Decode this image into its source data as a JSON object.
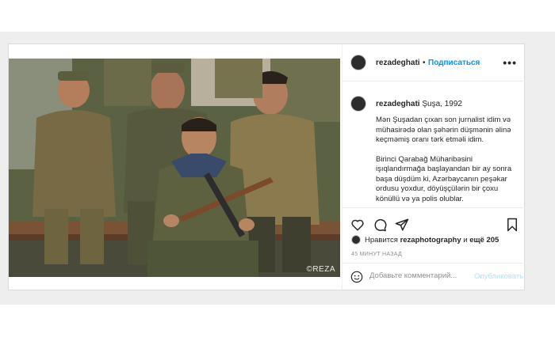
{
  "post": {
    "username": "rezadeghati",
    "follow_label": "Подписаться",
    "separator": "•",
    "more_label": "•••",
    "caption": {
      "username": "rezadeghati",
      "location_year": "Şuşa, 1992",
      "paragraphs": [
        "Mən Şuşadan çıxan son jurnalist idim və mühasirədə olan şəhərin düşmənin əlinə keçməmiş oranı tərk etməli idim.",
        "Birinci Qarabağ Müharibəsini işıqlandırmağa başlayandan bir ay sonra başa düşdüm ki, Azərbaycanın peşəkar ordusu yoxdur, döyüşçülərin bir çoxu könüllü və ya polis olublar."
      ]
    },
    "photo": {
      "watermark": "©REZA"
    },
    "likes": {
      "prefix": "Нравится",
      "user": "rezaphotography",
      "conjunction": "и",
      "others": "ещё 205"
    },
    "timestamp": "45 МИНУТ НАЗАД",
    "comment": {
      "placeholder": "Добавьте комментарий...",
      "publish_label": "Опубликовать"
    }
  },
  "colors": {
    "link_blue": "#0095f6",
    "publish_disabled": "#b2dffc",
    "muted_gray": "#8e8e8e"
  }
}
